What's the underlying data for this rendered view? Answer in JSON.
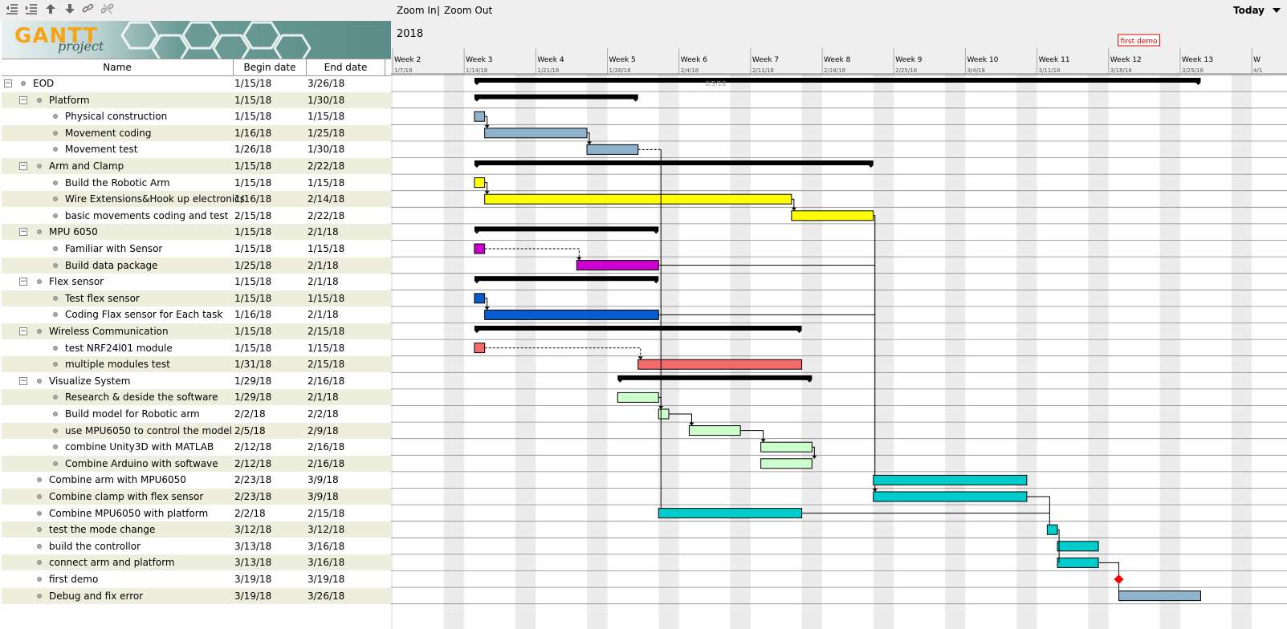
{
  "toolbar": {
    "icons": [
      "unindent-icon",
      "indent-icon",
      "move-up-icon",
      "move-down-icon",
      "link-icon",
      "unlink-icon"
    ]
  },
  "logo": {
    "title": "GANTT",
    "subtitle": "project"
  },
  "columns": {
    "name": "Name",
    "begin": "Begin date",
    "end": "End date"
  },
  "tasks": [
    {
      "name": "EOD",
      "begin": "1/15/18",
      "end": "3/26/18",
      "level": 0,
      "group": true
    },
    {
      "name": "Platform",
      "begin": "1/15/18",
      "end": "1/30/18",
      "level": 1,
      "group": true
    },
    {
      "name": "Physical construction",
      "begin": "1/15/18",
      "end": "1/15/18",
      "level": 2,
      "group": false
    },
    {
      "name": "Movement coding",
      "begin": "1/16/18",
      "end": "1/25/18",
      "level": 2,
      "group": false
    },
    {
      "name": "Movement test",
      "begin": "1/26/18",
      "end": "1/30/18",
      "level": 2,
      "group": false
    },
    {
      "name": "Arm and Clamp",
      "begin": "1/15/18",
      "end": "2/22/18",
      "level": 1,
      "group": true
    },
    {
      "name": "Build the Robotic Arm",
      "begin": "1/15/18",
      "end": "1/15/18",
      "level": 2,
      "group": false
    },
    {
      "name": "Wire Extensions&Hook up electronics",
      "begin": "1/16/18",
      "end": "2/14/18",
      "level": 2,
      "group": false
    },
    {
      "name": "basic movements coding and test",
      "begin": "2/15/18",
      "end": "2/22/18",
      "level": 2,
      "group": false
    },
    {
      "name": "MPU 6050",
      "begin": "1/15/18",
      "end": "2/1/18",
      "level": 1,
      "group": true
    },
    {
      "name": "Familiar with Sensor",
      "begin": "1/15/18",
      "end": "1/15/18",
      "level": 2,
      "group": false
    },
    {
      "name": "Build data package",
      "begin": "1/25/18",
      "end": "2/1/18",
      "level": 2,
      "group": false
    },
    {
      "name": "Flex sensor",
      "begin": "1/15/18",
      "end": "2/1/18",
      "level": 1,
      "group": true
    },
    {
      "name": "Test flex sensor",
      "begin": "1/15/18",
      "end": "1/15/18",
      "level": 2,
      "group": false
    },
    {
      "name": "Coding Flax sensor for Each task",
      "begin": "1/16/18",
      "end": "2/1/18",
      "level": 2,
      "group": false
    },
    {
      "name": "Wireless Communication",
      "begin": "1/15/18",
      "end": "2/15/18",
      "level": 1,
      "group": true
    },
    {
      "name": "test NRF24l01 module",
      "begin": "1/15/18",
      "end": "1/15/18",
      "level": 2,
      "group": false
    },
    {
      "name": "multiple modules test",
      "begin": "1/31/18",
      "end": "2/15/18",
      "level": 2,
      "group": false
    },
    {
      "name": "Visualize System",
      "begin": "1/29/18",
      "end": "2/16/18",
      "level": 1,
      "group": true
    },
    {
      "name": "Research & deside the software",
      "begin": "1/29/18",
      "end": "2/1/18",
      "level": 2,
      "group": false
    },
    {
      "name": "Build  model for Robotic arm",
      "begin": "2/2/18",
      "end": "2/2/18",
      "level": 2,
      "group": false
    },
    {
      "name": "use MPU6050 to control the model",
      "begin": "2/5/18",
      "end": "2/9/18",
      "level": 2,
      "group": false
    },
    {
      "name": "combine Unity3D with MATLAB",
      "begin": "2/12/18",
      "end": "2/16/18",
      "level": 2,
      "group": false
    },
    {
      "name": "Combine Arduino with softwave",
      "begin": "2/12/18",
      "end": "2/16/18",
      "level": 2,
      "group": false
    },
    {
      "name": "Combine arm with MPU6050",
      "begin": "2/23/18",
      "end": "3/9/18",
      "level": 1,
      "group": false
    },
    {
      "name": "Combine clamp with flex sensor",
      "begin": "2/23/18",
      "end": "3/9/18",
      "level": 1,
      "group": false
    },
    {
      "name": "Combine MPU6050 with platform",
      "begin": "2/2/18",
      "end": "2/15/18",
      "level": 1,
      "group": false
    },
    {
      "name": "test the mode change",
      "begin": "3/12/18",
      "end": "3/12/18",
      "level": 1,
      "group": false
    },
    {
      "name": "build the controllor",
      "begin": "3/13/18",
      "end": "3/16/18",
      "level": 1,
      "group": false
    },
    {
      "name": "connect arm and platform",
      "begin": "3/13/18",
      "end": "3/16/18",
      "level": 1,
      "group": false
    },
    {
      "name": "first demo",
      "begin": "3/19/18",
      "end": "3/19/18",
      "level": 1,
      "group": false
    },
    {
      "name": "Debug and fix error",
      "begin": "3/19/18",
      "end": "3/26/18",
      "level": 1,
      "group": false
    }
  ],
  "chart": {
    "zoom_in": "Zoom In",
    "separator": "|",
    "zoom_out": "Zoom Out",
    "today": "Today",
    "year": "2018",
    "milestone_label": "first demo",
    "eod_date_label": "2/5/18",
    "weeks": [
      {
        "label": "Week 2",
        "date": "1/7/18"
      },
      {
        "label": "Week 3",
        "date": "1/14/18"
      },
      {
        "label": "Week 4",
        "date": "1/21/18"
      },
      {
        "label": "Week 5",
        "date": "1/28/18"
      },
      {
        "label": "Week 6",
        "date": "2/4/18"
      },
      {
        "label": "Week 7",
        "date": "2/11/18"
      },
      {
        "label": "Week 8",
        "date": "2/18/18"
      },
      {
        "label": "Week 9",
        "date": "2/25/18"
      },
      {
        "label": "Week 10",
        "date": "3/4/18"
      },
      {
        "label": "Week 11",
        "date": "3/11/18"
      },
      {
        "label": "Week 12",
        "date": "3/18/18"
      },
      {
        "label": "Week 13",
        "date": "3/25/18"
      },
      {
        "label": "W",
        "date": "4/1"
      }
    ],
    "colors": {
      "platform": "#8fb3cc",
      "arm": "#ffff00",
      "mpu": "#cc00cc",
      "flex": "#0a5ccc",
      "wireless": "#f46b6b",
      "visualize": "#ccffcc",
      "integration": "#00cccc",
      "debug": "#8fb3cc",
      "summary": "#000000",
      "milestone": "#ff0000",
      "weekend": "#ececec"
    },
    "bar_colors": [
      "summary",
      "summary",
      "platform",
      "platform",
      "platform",
      "summary",
      "arm",
      "arm",
      "arm",
      "summary",
      "mpu",
      "mpu",
      "summary",
      "flex",
      "flex",
      "summary",
      "wireless",
      "wireless",
      "summary",
      "visualize",
      "visualize",
      "visualize",
      "visualize",
      "visualize",
      "integration",
      "integration",
      "integration",
      "integration",
      "integration",
      "integration",
      "milestone",
      "debug"
    ]
  }
}
